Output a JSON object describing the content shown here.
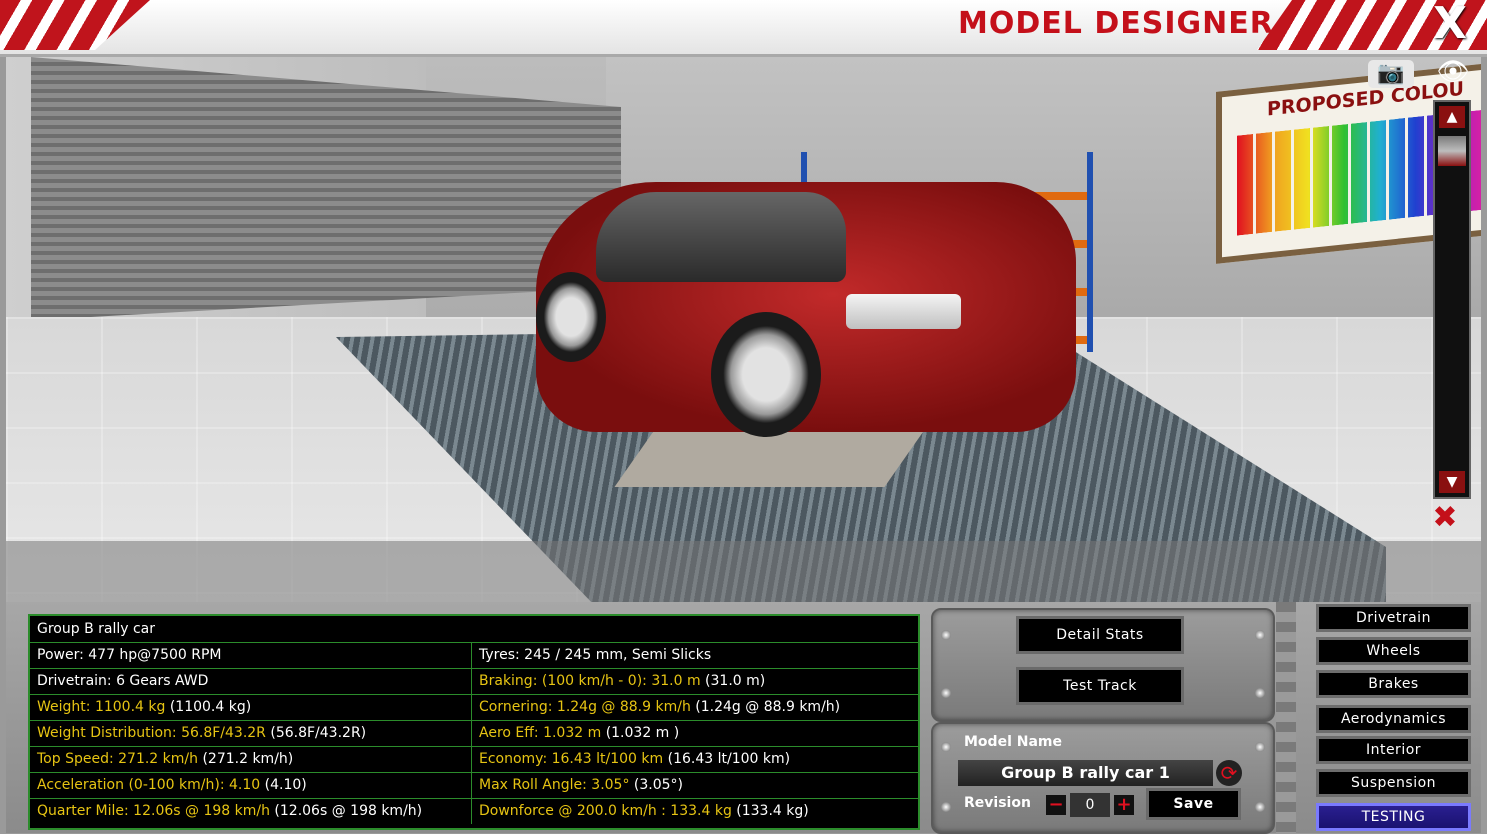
{
  "header": {
    "title": "MODEL DESIGNER",
    "close_label": "X"
  },
  "viewport": {
    "board_title": "PROPOSED COLOU",
    "icons": [
      "camera-icon",
      "eye-icon",
      "scroll-up-icon",
      "scroll-down-icon",
      "reset-view-icon"
    ]
  },
  "stats": {
    "title": "Group B rally car",
    "rows": [
      {
        "left": {
          "label": "Power: 477 hp@7500 RPM",
          "paren": ""
        },
        "right": {
          "label": "Tyres: 245 / 245 mm, Semi Slicks",
          "paren": ""
        }
      },
      {
        "left": {
          "label": "Drivetrain: 6 Gears AWD",
          "paren": ""
        },
        "right": {
          "label": "Braking: (100 km/h - 0): 31.0 m",
          "paren": "(31.0 m)"
        }
      },
      {
        "left": {
          "label": "Weight: 1100.4 kg",
          "paren": "(1100.4 kg)"
        },
        "right": {
          "label": "Cornering: 1.24g @ 88.9 km/h",
          "paren": "(1.24g @ 88.9 km/h)"
        }
      },
      {
        "left": {
          "label": "Weight Distribution: 56.8F/43.2R",
          "paren": "(56.8F/43.2R)"
        },
        "right": {
          "label": "Aero Eff: 1.032 m",
          "paren": "(1.032 m )"
        }
      },
      {
        "left": {
          "label": "Top Speed: 271.2 km/h",
          "paren": "(271.2 km/h)"
        },
        "right": {
          "label": "Economy: 16.43 lt/100 km",
          "paren": "(16.43 lt/100 km)"
        }
      },
      {
        "left": {
          "label": "Acceleration (0-100 km/h): 4.10",
          "paren": "(4.10)"
        },
        "right": {
          "label": "Max Roll Angle: 3.05°",
          "paren": "(3.05°)"
        }
      },
      {
        "left": {
          "label": "Quarter Mile: 12.06s @ 198 km/h",
          "paren": "(12.06s @ 198 km/h)"
        },
        "right": {
          "label": "Downforce @ 200.0 km/h : 133.4 kg",
          "paren": "(133.4 kg)"
        }
      }
    ]
  },
  "actions": {
    "detail_stats": "Detail Stats",
    "test_track": "Test Track"
  },
  "model": {
    "name_label": "Model Name",
    "name_value": "Group B rally  car 1",
    "revision_label": "Revision",
    "revision_value": "0",
    "minus": "−",
    "plus": "+",
    "save_label": "Save"
  },
  "nav": {
    "drivetrain": "Drivetrain",
    "wheels": "Wheels",
    "brakes": "Brakes",
    "aerodynamics": "Aerodynamics",
    "interior": "Interior",
    "suspension": "Suspension",
    "testing": "TESTING",
    "active": "testing"
  }
}
